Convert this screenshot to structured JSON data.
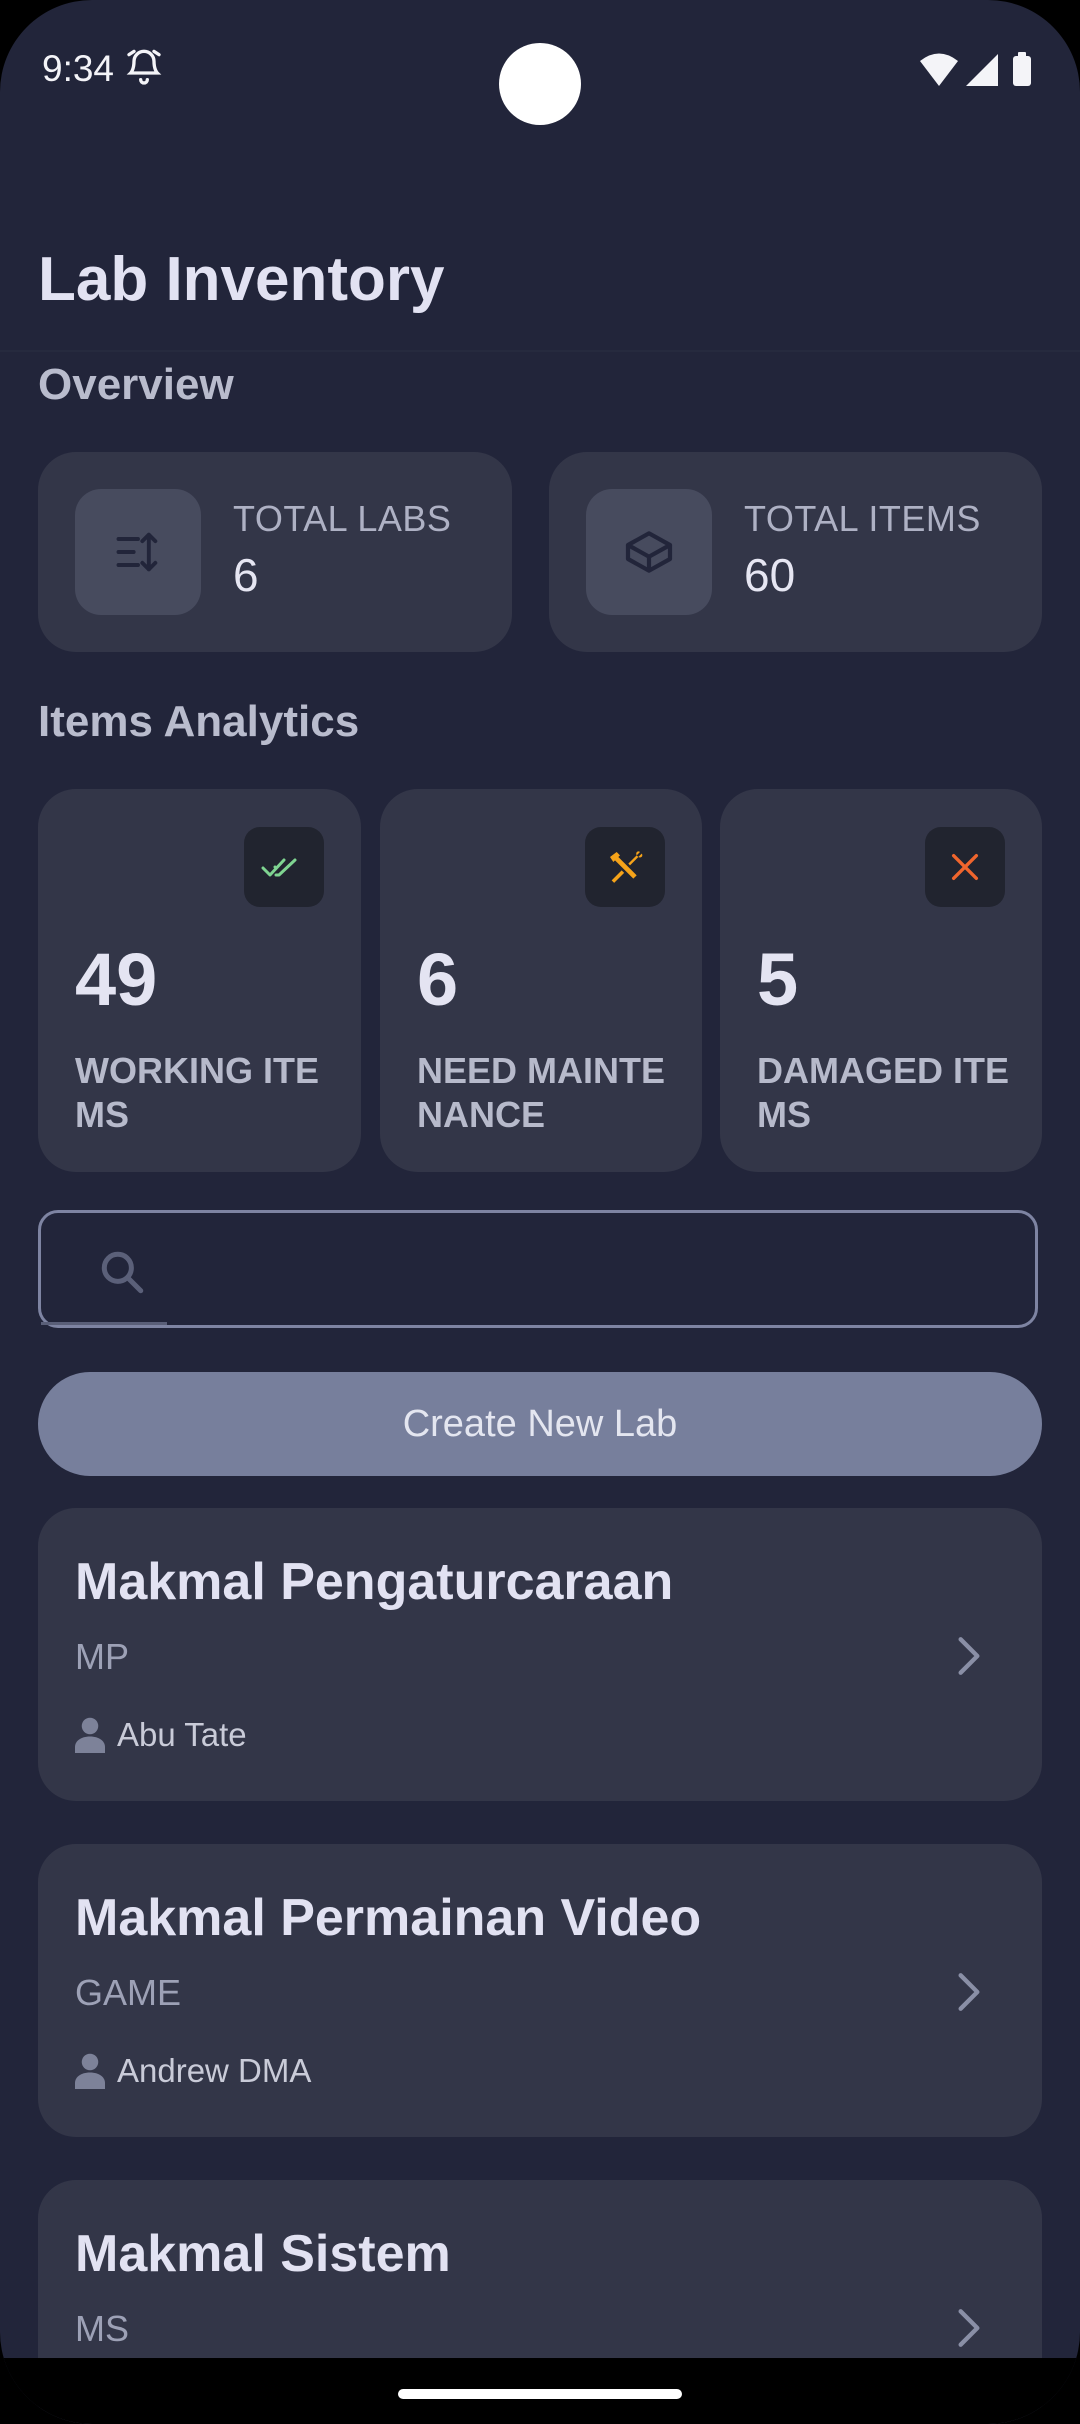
{
  "status_bar": {
    "time": "9:34"
  },
  "app": {
    "title": "Lab Inventory"
  },
  "overview": {
    "heading": "Overview",
    "total_labs": {
      "label": "TOTAL LABS",
      "value": "6"
    },
    "total_items": {
      "label": "TOTAL ITEMS",
      "value": "60"
    }
  },
  "analytics": {
    "heading": "Items Analytics",
    "working": {
      "value": "49",
      "label": "WORKING ITEMS",
      "color": "#7fd491"
    },
    "maintenance": {
      "value": "6",
      "label": "NEED MAINTENANCE",
      "color": "#f5a31a"
    },
    "damaged": {
      "value": "5",
      "label": "DAMAGED ITEMS",
      "color": "#f0652d"
    }
  },
  "search": {
    "value": "",
    "placeholder": ""
  },
  "create_button": {
    "label": "Create New Lab"
  },
  "labs": [
    {
      "name": "Makmal Pengaturcaraan",
      "code": "MP",
      "person": "Abu Tate"
    },
    {
      "name": "Makmal Permainan Video",
      "code": "GAME",
      "person": "Andrew DMA"
    },
    {
      "name": "Makmal Sistem",
      "code": "MS",
      "person": ""
    }
  ],
  "colors": {
    "background": "#22253a",
    "card": "#333648",
    "accent": "#777f9c"
  }
}
